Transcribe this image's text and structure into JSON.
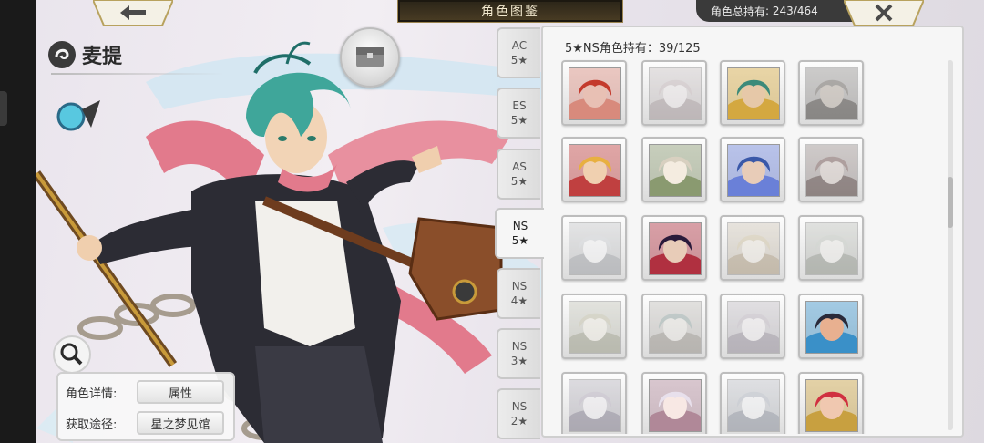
{
  "header": {
    "title": "角色图鉴",
    "holding_label": "角色总持有",
    "holding_value": "243/464"
  },
  "character": {
    "name": "麦提",
    "info_rows": [
      {
        "label": "角色详情:",
        "value": "属性"
      },
      {
        "label": "获取途径:",
        "value": "星之梦见馆"
      }
    ]
  },
  "tabs": [
    {
      "line1": "AC",
      "line2": "5★",
      "active": false
    },
    {
      "line1": "ES",
      "line2": "5★",
      "active": false
    },
    {
      "line1": "AS",
      "line2": "5★",
      "active": false
    },
    {
      "line1": "NS",
      "line2": "5★",
      "active": true
    },
    {
      "line1": "NS",
      "line2": "4★",
      "active": false
    },
    {
      "line1": "NS",
      "line2": "3★",
      "active": false
    },
    {
      "line1": "NS",
      "line2": "2★",
      "active": false
    }
  ],
  "panel": {
    "heading_prefix": "5★NS角色持有：",
    "heading_value": "39/125"
  },
  "grid_cells": [
    {
      "owned": true,
      "palette": [
        "#c43a2c",
        "#e8c0b4",
        "#d88a7c"
      ]
    },
    {
      "owned": false,
      "palette": [
        "#d8b0b8",
        "#f0e0e4",
        "#b89098"
      ]
    },
    {
      "owned": true,
      "palette": [
        "#3c8a7a",
        "#e6c8a8",
        "#d4a840"
      ]
    },
    {
      "owned": false,
      "palette": [
        "#7a6a5a",
        "#c8a888",
        "#4a3c30"
      ]
    },
    {
      "owned": true,
      "palette": [
        "#e8b040",
        "#f0d0b0",
        "#c04040"
      ]
    },
    {
      "owned": true,
      "palette": [
        "#d8d0c0",
        "#f4ece0",
        "#8a9a70"
      ]
    },
    {
      "owned": true,
      "palette": [
        "#3a58a8",
        "#e8ccb8",
        "#6a80d8"
      ]
    },
    {
      "owned": false,
      "palette": [
        "#a85048",
        "#e4c0b0",
        "#703028"
      ]
    },
    {
      "owned": false,
      "palette": [
        "#c8d0dc",
        "#f0f0f4",
        "#98a0b0"
      ]
    },
    {
      "owned": true,
      "palette": [
        "#2a1a3a",
        "#e8ccb8",
        "#b03040"
      ]
    },
    {
      "owned": false,
      "palette": [
        "#e8c060",
        "#f4e4c8",
        "#d09840"
      ]
    },
    {
      "owned": false,
      "palette": [
        "#b8c8b0",
        "#ece8dc",
        "#889878"
      ]
    },
    {
      "owned": false,
      "palette": [
        "#c8c078",
        "#f0e8c8",
        "#9aa060"
      ]
    },
    {
      "owned": false,
      "palette": [
        "#78b0a8",
        "#e8e0d0",
        "#a09078"
      ]
    },
    {
      "owned": false,
      "palette": [
        "#c8b0d0",
        "#f0e4ec",
        "#a088b0"
      ]
    },
    {
      "owned": true,
      "palette": [
        "#2a2a3a",
        "#e8b090",
        "#3a90c8"
      ]
    },
    {
      "owned": false,
      "palette": [
        "#c0a8d8",
        "#f0e8f4",
        "#8878b0"
      ]
    },
    {
      "owned": true,
      "palette": [
        "#e8e0ec",
        "#f8e8e4",
        "#b08898"
      ]
    },
    {
      "owned": false,
      "palette": [
        "#a8b8d8",
        "#eceef4",
        "#8090b8"
      ]
    },
    {
      "owned": true,
      "palette": [
        "#d03040",
        "#f0c8b0",
        "#c8a040"
      ]
    }
  ],
  "colors": {
    "hair": "#3fa69a",
    "hair_dark": "#1f6e68",
    "scarf": "#e27a8c",
    "coat": "#2c2c34",
    "bag": "#8a4e2a",
    "staff_gold": "#c89a3a"
  },
  "icons": {
    "back": "arrow-left-icon",
    "close": "close-x-icon",
    "search": "magnifier-icon",
    "name": "element-swirl-icon",
    "profile": "chest-box-icon"
  }
}
